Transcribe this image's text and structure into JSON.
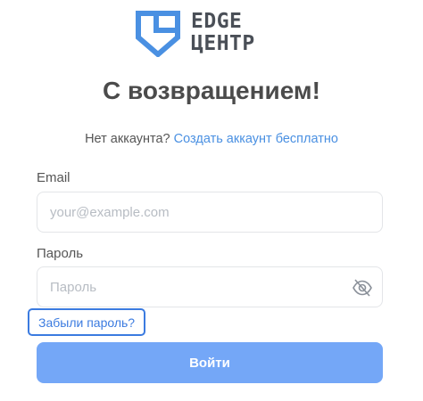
{
  "brand": {
    "name_line1": "EDGE",
    "name_line2": "ЦЕНТР",
    "logo_icon": "shield-logo-icon",
    "accent_color": "#4a90e2"
  },
  "heading": {
    "title": "С возвращением!"
  },
  "signup": {
    "prompt": "Нет аккаунта?",
    "link_label": "Создать аккаунт бесплатно"
  },
  "form": {
    "email_label": "Email",
    "email_placeholder": "your@example.com",
    "email_value": "",
    "password_label": "Пароль",
    "password_placeholder": "Пароль",
    "password_value": "",
    "password_toggle_icon": "eye-off-icon",
    "forgot_label": "Забыли пароль?",
    "submit_label": "Войти",
    "submit_color": "#74a7f7"
  }
}
